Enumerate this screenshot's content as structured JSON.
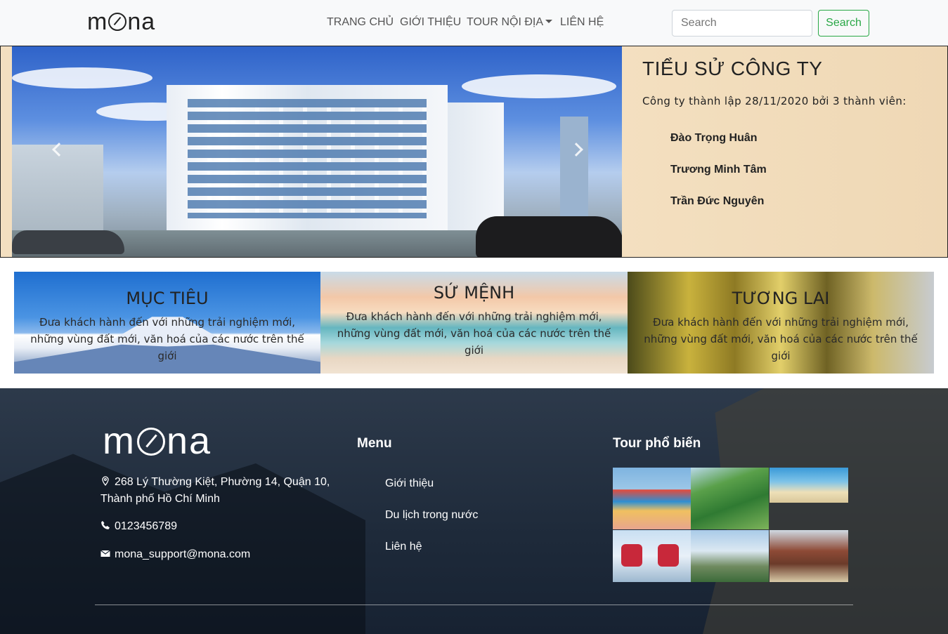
{
  "nav": {
    "logo": "mona",
    "links": [
      "TRANG CHỦ",
      "GIỚI THIỆU",
      "TOUR NỘI ĐỊA",
      "LIÊN HỆ"
    ],
    "search_placeholder": "Search",
    "search_button": "Search"
  },
  "hero": {
    "title": "TIỂU SỬ CÔNG TY",
    "subtitle": "Công ty thành lập 28/11/2020 bởi 3 thành viên:",
    "members": [
      "Đào Trọng Huân",
      "Trương Minh Tâm",
      "Trần Đức Nguyên"
    ]
  },
  "cards": [
    {
      "title": "MỤC TIÊU",
      "text": "Đưa khách hành đến với những trải nghiệm mới, những vùng đất mới, văn hoá của các nước trên thế giới"
    },
    {
      "title": "SỨ MỆNH",
      "text": "Đưa khách hành đến với những trải nghiệm mới, những vùng đất mới, văn hoá của các nước trên thế giới"
    },
    {
      "title": "TƯƠNG LAI",
      "text": "Đưa khách hành đến với những trải nghiệm mới, những vùng đất mới, văn hoá của các nước trên thế giới"
    }
  ],
  "footer": {
    "logo": "mona",
    "address_line1": "268 Lý Thường Kiệt, Phường 14, Quận 10,",
    "address_line2": "Thành phố Hồ Chí Minh",
    "phone": "0123456789",
    "email": "mona_support@mona.com",
    "menu_heading": "Menu",
    "menu_items": [
      "Giới thiệu",
      "Du lịch trong nước",
      "Liên hệ"
    ],
    "tours_heading": "Tour phổ biến"
  }
}
